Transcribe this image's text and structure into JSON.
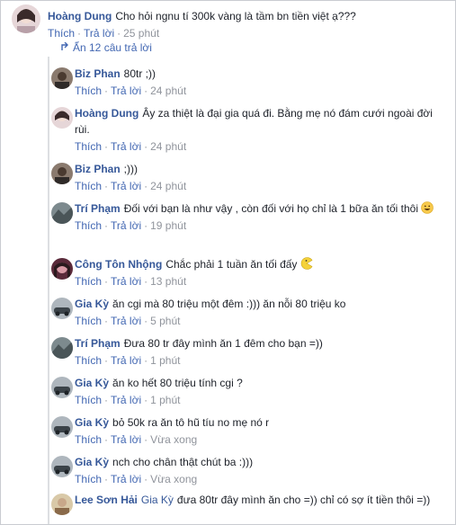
{
  "main_comment": {
    "author": "Hoàng Dung",
    "text": "Cho hỏi ngnu tí 300k vàng là tầm bn tiền việt ạ???",
    "like": "Thích",
    "reply": "Trả lời",
    "time": "25 phút"
  },
  "hide_replies_label": "Ẩn 12 câu trả lời",
  "replies": [
    {
      "author": "Biz Phan",
      "text": "80tr ;))",
      "like": "Thích",
      "reply": "Trả lời",
      "time": "24 phút"
    },
    {
      "author": "Hoàng Dung",
      "text": "Ây za thiệt là đại gia quá đi. Bằng mẹ nó đám cưới ngoài đời rùi.",
      "like": "Thích",
      "reply": "Trả lời",
      "time": "24 phút"
    },
    {
      "author": "Biz Phan",
      "text": ";)))",
      "like": "Thích",
      "reply": "Trả lời",
      "time": "24 phút"
    },
    {
      "author": "Trí Phạm",
      "text": "Đối với bạn là như vậy , còn đối với họ chỉ là 1 bữa ăn tối thôi",
      "like": "Thích",
      "reply": "Trả lời",
      "time": "19 phút"
    },
    {
      "author": "Công Tôn Nhộng",
      "text": "Chắc phải 1 tuần ăn tối đấy",
      "like": "Thích",
      "reply": "Trả lời",
      "time": "13 phút"
    },
    {
      "author": "Gia Kỳ",
      "text": "ăn cgi mà 80 triệu một đêm :))) ăn nỗi 80 triệu ko",
      "like": "Thích",
      "reply": "Trả lời",
      "time": "5 phút"
    },
    {
      "author": "Trí Phạm",
      "text": "Đưa 80 tr đây mình ăn 1 đêm cho bạn =))",
      "like": "Thích",
      "reply": "Trả lời",
      "time": "1 phút"
    },
    {
      "author": "Gia Kỳ",
      "text": "ăn ko hết 80 triệu tính cgi ?",
      "like": "Thích",
      "reply": "Trả lời",
      "time": "1 phút"
    },
    {
      "author": "Gia Kỳ",
      "text": "bỏ 50k ra ăn tô hũ tíu no mẹ nó r",
      "like": "Thích",
      "reply": "Trả lời",
      "time": "Vừa xong"
    },
    {
      "author": "Gia Kỳ",
      "text": "nch cho chân thật chút ba :)))",
      "like": "Thích",
      "reply": "Trả lời",
      "time": "Vừa xong"
    },
    {
      "author": "Lee Sơn Hải",
      "mention": "Gia Kỳ",
      "text": "đưa 80tr đây mình ăn cho =)) chỉ có sợ ít tiền thôi =))"
    }
  ],
  "colors": {
    "link": "#365899",
    "action": "#4267b2",
    "meta": "#90949c",
    "text": "#1d2129"
  }
}
